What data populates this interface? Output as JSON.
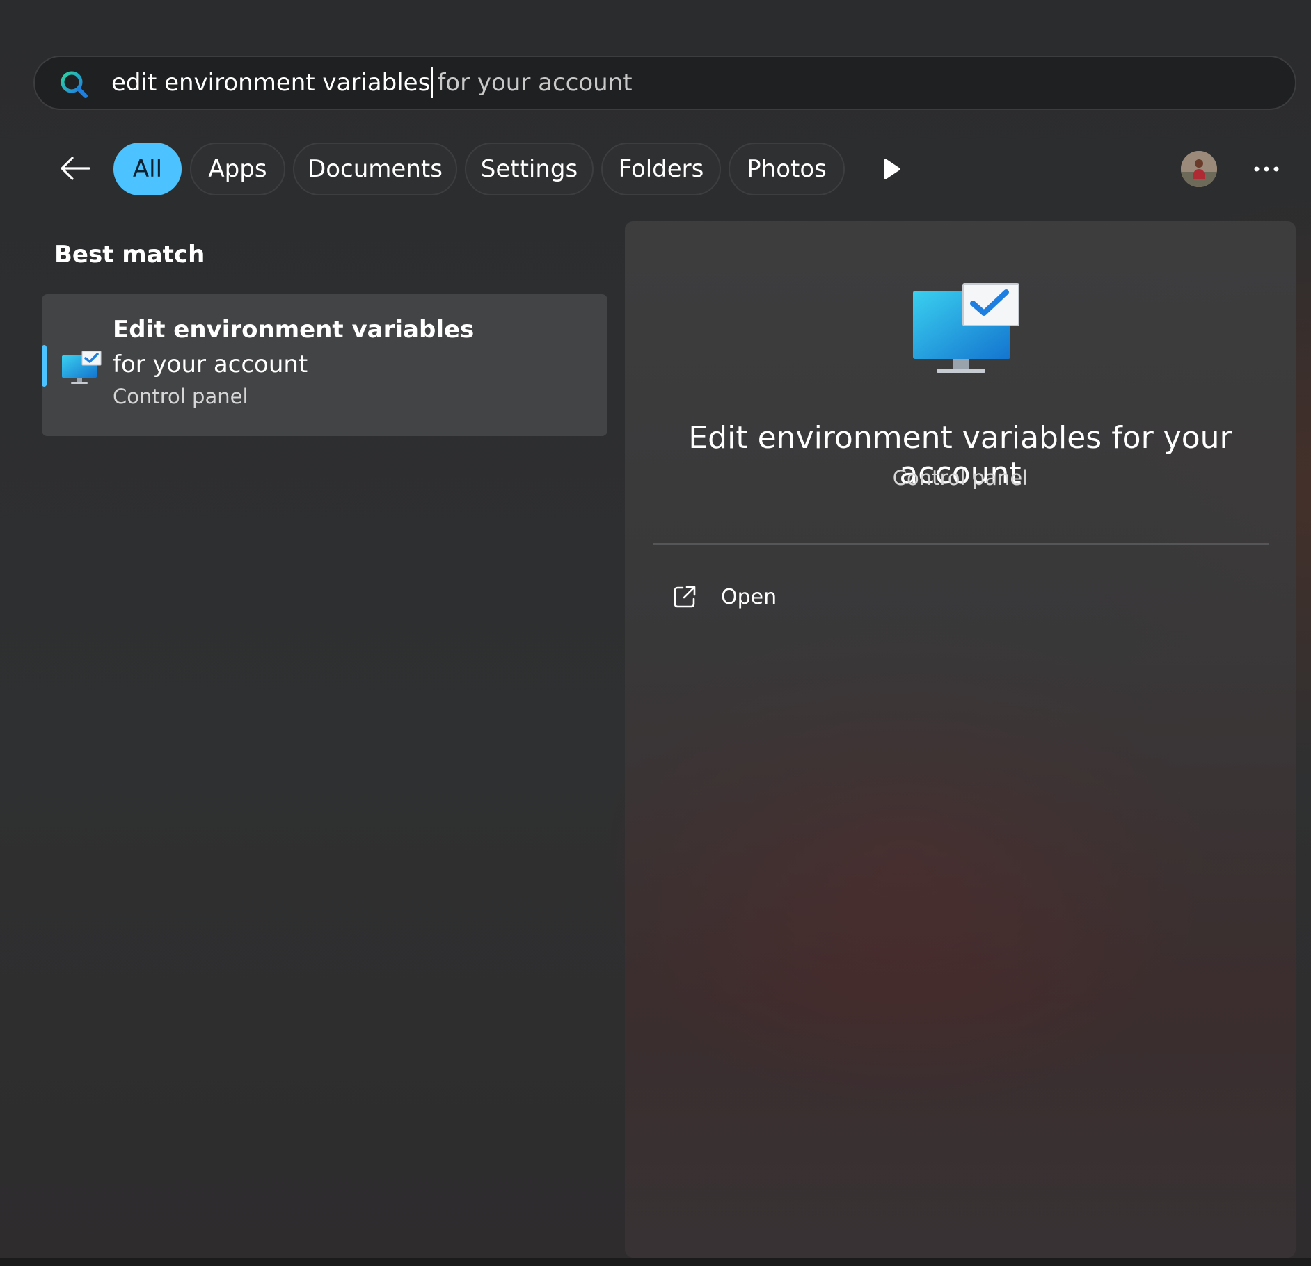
{
  "search": {
    "query_typed": "edit environment variables",
    "query_suggestion": "for your account"
  },
  "filters": {
    "chips": [
      {
        "label": "All",
        "active": true
      },
      {
        "label": "Apps",
        "active": false
      },
      {
        "label": "Documents",
        "active": false
      },
      {
        "label": "Settings",
        "active": false
      },
      {
        "label": "Folders",
        "active": false
      },
      {
        "label": "Photos",
        "active": false
      }
    ],
    "more_label": "•••"
  },
  "results": {
    "section_heading": "Best match",
    "best_match": {
      "title_bold": "Edit environment variables",
      "title_rest": " for your account",
      "subtitle": "Control panel"
    }
  },
  "preview": {
    "title": "Edit environment variables for your account",
    "subtitle": "Control panel",
    "actions": [
      {
        "label": "Open",
        "icon": "open-external-icon"
      }
    ]
  },
  "colors": {
    "accent": "#4cc2ff",
    "background": "#2a2b2d",
    "result_bg": "#434445"
  }
}
